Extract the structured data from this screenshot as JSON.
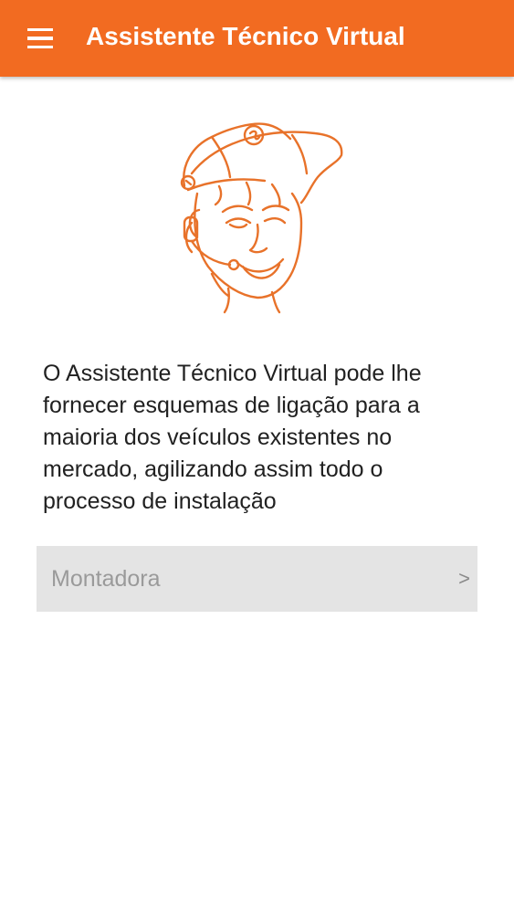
{
  "app_bar": {
    "title": "Assistente Técnico Virtual",
    "menu_icon": "menu-icon",
    "color": "#f26b21"
  },
  "mascot": {
    "icon": "technician-mascot-illustration"
  },
  "main": {
    "description": "O Assistente Técnico Virtual pode lhe fornecer esquemas de ligação para a maioria dos veículos existentes no mercado, agilizando assim todo o processo de instalação"
  },
  "selector": {
    "label": "Montadora",
    "chevron": ">"
  }
}
